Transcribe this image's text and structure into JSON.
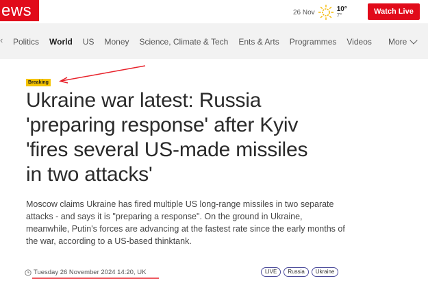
{
  "header": {
    "logo_text": "ews",
    "weather": {
      "date": "26 Nov",
      "high": "10°",
      "low": "7°",
      "icon": "sun-cloud-icon"
    },
    "watch_live_label": "Watch Live",
    "brand_color": "#e10b1a"
  },
  "nav": {
    "items": [
      {
        "label": "Politics",
        "active": false
      },
      {
        "label": "World",
        "active": true
      },
      {
        "label": "US",
        "active": false
      },
      {
        "label": "Money",
        "active": false
      },
      {
        "label": "Science, Climate & Tech",
        "active": false
      },
      {
        "label": "Ents & Arts",
        "active": false
      },
      {
        "label": "Programmes",
        "active": false
      },
      {
        "label": "Videos",
        "active": false
      }
    ],
    "more_label": "More"
  },
  "article": {
    "badge": "Breaking",
    "badge_color": "#f5c400",
    "headline": "Ukraine war latest: Russia 'preparing response' after Kyiv 'fires several US-made missiles in two attacks'",
    "summary": "Moscow claims Ukraine has fired multiple US long-range missiles in two separate attacks - and says it is \"preparing a response\". On the ground in Ukraine, meanwhile, Putin's forces are advancing at the fastest rate since the early months of the war, according to a US-based thinktank.",
    "timestamp": "Tuesday 26 November 2024 14:20, UK",
    "tags": [
      "LIVE",
      "Russia",
      "Ukraine"
    ]
  },
  "annotations": {
    "color": "#e8222b"
  }
}
